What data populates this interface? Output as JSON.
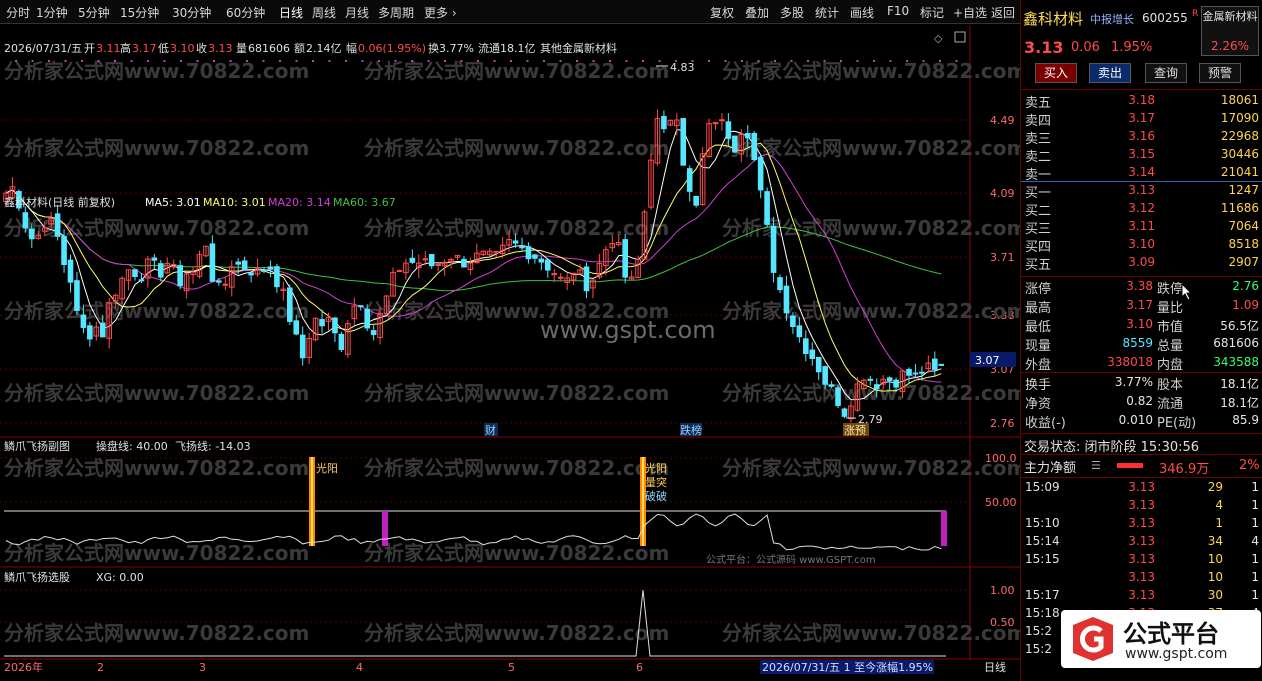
{
  "toolbar": {
    "timeframes": [
      "分时",
      "1分钟",
      "5分钟",
      "15分钟",
      "30分钟",
      "60分钟",
      "日线",
      "周线",
      "月线",
      "多周期",
      "更多 ›"
    ],
    "buttons": [
      "复权",
      "叠加",
      "多股",
      "统计",
      "画线",
      "F10",
      "标记",
      "+自选",
      "返回"
    ]
  },
  "header": {
    "date_line": "2026/07/31/五",
    "open_label": "开",
    "open": "3.11",
    "high_label": "高",
    "high": "3.17",
    "low_label": "低",
    "low": "3.10",
    "close_label": "收",
    "close": "3.13",
    "vol_label": "量",
    "vol": "681606",
    "amt_label": "额",
    "amt": "2.14亿",
    "range_label": "幅",
    "range": "0.06(1.95%)",
    "turn": "换3.77%",
    "float": "流通18.1亿",
    "sector": "其他金属新材料"
  },
  "main_chart": {
    "title": "鑫科材料(日线 前复权)",
    "ma5": "MA5: 3.01",
    "ma10": "MA10: 3.01",
    "ma20": "MA20: 3.14",
    "ma60": "MA60: 3.67",
    "ytick_labels": [
      "4.49",
      "4.09",
      "3.71",
      "3.38",
      "3.07",
      "2.76"
    ],
    "high_mark": "4.83",
    "low_mark": "2.79",
    "current_price_tag": "3.07",
    "events": [
      "财",
      "跌榜",
      "涨预"
    ],
    "watermark_center": "www.gspt.com",
    "watermark_repeat": "分析家公式网www.70822.com"
  },
  "sub1": {
    "title": "鳞爪飞扬副图",
    "field1": "操盘线: 40.00",
    "field2": "飞扬线: -14.03",
    "ytick_labels": [
      "100.0",
      "50.00"
    ],
    "marks": [
      "光阳",
      "光阳",
      "量突",
      "破破"
    ],
    "footer_note": "公式平台：公式源码 www.GSPT.com"
  },
  "sub2": {
    "title": "鳞爪飞扬选股",
    "field": "XG: 0.00",
    "ytick_labels": [
      "1.00",
      "0.50"
    ]
  },
  "xaxis": {
    "labels": [
      "2026年",
      "2",
      "3",
      "4",
      "5",
      "6"
    ],
    "status": "2026/07/31/五 1 至今涨幅1.95%",
    "period": "日线"
  },
  "right_panel": {
    "name": "鑫科材料",
    "tag": "中报增长",
    "code": "600255",
    "r_mark": "R",
    "industry": "金属新材料",
    "industry_pct": "2.26%",
    "price": "3.13",
    "change": "0.06",
    "pct": "1.95%",
    "actions": [
      "买入",
      "卖出",
      "查询",
      "预警"
    ],
    "sell": [
      {
        "label": "卖五",
        "price": "3.18",
        "vol": "18061"
      },
      {
        "label": "卖四",
        "price": "3.17",
        "vol": "17090"
      },
      {
        "label": "卖三",
        "price": "3.16",
        "vol": "22968"
      },
      {
        "label": "卖二",
        "price": "3.15",
        "vol": "30446"
      },
      {
        "label": "卖一",
        "price": "3.14",
        "vol": "21041"
      }
    ],
    "buy": [
      {
        "label": "买一",
        "price": "3.13",
        "vol": "1247"
      },
      {
        "label": "买二",
        "price": "3.12",
        "vol": "11686"
      },
      {
        "label": "买三",
        "price": "3.11",
        "vol": "7064"
      },
      {
        "label": "买四",
        "price": "3.10",
        "vol": "8518"
      },
      {
        "label": "买五",
        "price": "3.09",
        "vol": "2907"
      }
    ],
    "stats": [
      {
        "l1": "涨停",
        "v1": "3.38",
        "c1": "red",
        "l2": "跌停",
        "v2": "2.76",
        "c2": "grn"
      },
      {
        "l1": "最高",
        "v1": "3.17",
        "c1": "red",
        "l2": "量比",
        "v2": "1.09",
        "c2": "red"
      },
      {
        "l1": "最低",
        "v1": "3.10",
        "c1": "red",
        "l2": "市值",
        "v2": "56.5亿",
        "c2": "wht"
      },
      {
        "l1": "现量",
        "v1": "8559",
        "c1": "cyn",
        "l2": "总量",
        "v2": "681606",
        "c2": "wht"
      },
      {
        "l1": "外盘",
        "v1": "338018",
        "c1": "red",
        "l2": "内盘",
        "v2": "343588",
        "c2": "grn"
      }
    ],
    "stats2": [
      {
        "l1": "换手",
        "v1": "3.77%",
        "l2": "股本",
        "v2": "18.1亿"
      },
      {
        "l1": "净资",
        "v1": "0.82",
        "l2": "流通",
        "v2": "18.1亿"
      },
      {
        "l1": "收益(-)",
        "v1": "0.010",
        "l2": "PE(动)",
        "v2": "85.9"
      }
    ],
    "trade_status": "交易状态: 闭市阶段 15:30:56",
    "main_flow_label": "主力净额",
    "main_flow_value": "346.9万",
    "main_flow_pct": "2%",
    "ticks": [
      {
        "t": "15:09",
        "p": "3.13",
        "v": "29",
        "n": "1"
      },
      {
        "t": "",
        "p": "3.13",
        "v": "4",
        "n": "1"
      },
      {
        "t": "15:10",
        "p": "3.13",
        "v": "1",
        "n": "1"
      },
      {
        "t": "15:14",
        "p": "3.13",
        "v": "34",
        "n": "4"
      },
      {
        "t": "15:15",
        "p": "3.13",
        "v": "10",
        "n": "1"
      },
      {
        "t": "",
        "p": "3.13",
        "v": "10",
        "n": "1"
      },
      {
        "t": "15:17",
        "p": "3.13",
        "v": "30",
        "n": "1"
      },
      {
        "t": "15:18",
        "p": "3.13",
        "v": "37",
        "n": "4"
      },
      {
        "t": "15:2",
        "p": "",
        "v": "",
        "n": ""
      },
      {
        "t": "15:2",
        "p": "",
        "v": "",
        "n": ""
      }
    ],
    "logo_text": "公式平台",
    "logo_url": "www.gspt.com"
  },
  "colors": {
    "up": "#ff4b4b",
    "down": "#54e7ff",
    "ma5": "#ffffff",
    "ma10": "#ffff66",
    "ma20": "#d040d0",
    "ma60": "#40c040"
  }
}
